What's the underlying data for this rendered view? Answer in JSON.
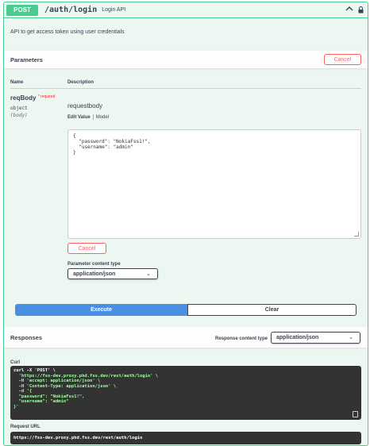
{
  "operation": {
    "method": "POST",
    "path": "/auth/login",
    "summary": "Login API",
    "description": "API to get access token using user credentials",
    "colors": {
      "accent": "#49cc90",
      "background": "#edf7f2"
    },
    "icons": {
      "collapse": "chevron-up-icon",
      "lock": "lock-icon"
    }
  },
  "parameters": {
    "title": "Parameters",
    "cancel_label": "Cancel",
    "col_name": "Name",
    "col_description": "Description",
    "param": {
      "name": "reqBody",
      "required_mark": "* required",
      "type": "object",
      "in": "(body)",
      "title": "requestbody",
      "tab_edit": "Edit Value",
      "tab_model": "Model",
      "body_lines": [
        "{",
        "  \"password\": \"NokiaFss1!\",",
        "  \"username\": \"admin\"",
        "}"
      ]
    },
    "param_cancel_label": "Cancel",
    "content_type_label": "Parameter content type",
    "content_type_value": "application/json"
  },
  "actions": {
    "execute_label": "Execute",
    "clear_label": "Clear",
    "execute_color": "#4990e2"
  },
  "responses": {
    "title": "Responses",
    "content_type_label": "Response content type",
    "content_type_value": "application/json",
    "curl_label": "Curl",
    "curl": {
      "l1": "curl -X 'POST' \\",
      "l2": "  'https://fss-dev.proxy.phd.fss.dev/rest/auth/login' \\",
      "l3": "  -H 'accept: application/json' \\",
      "l4": "  -H 'Content-Type: application/json' \\",
      "l5": "  -d '{",
      "l6": "  \"password\": \"NokiaFss1!\",",
      "l7": "  \"username\": \"admin\"",
      "l8": "}'"
    },
    "request_url_label": "Request URL",
    "request_url": "https://fss-dev.proxy.phd.fss.dev/rest/auth/login"
  }
}
